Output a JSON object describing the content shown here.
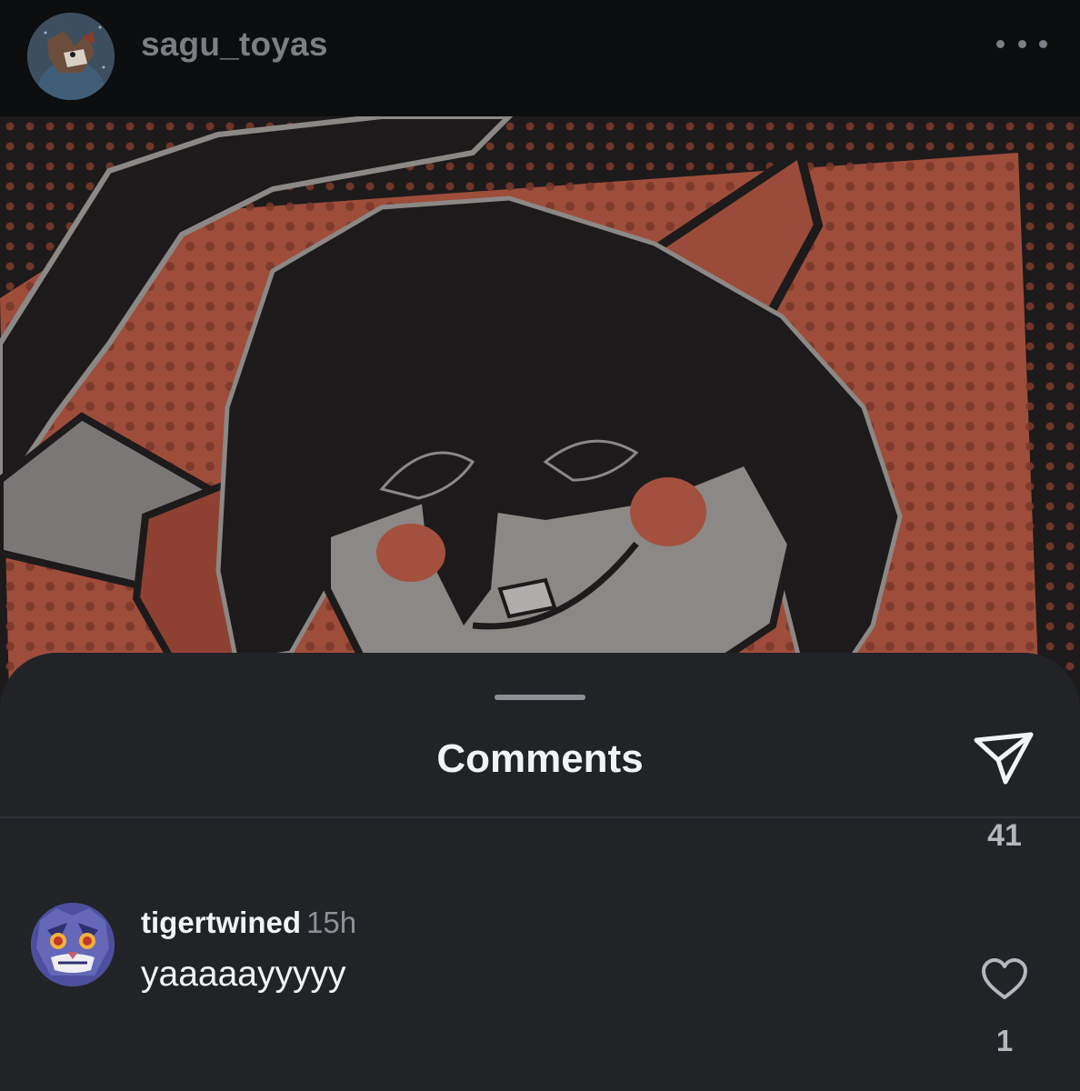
{
  "post": {
    "username": "sagu_toyas",
    "image_description_icon": "artwork-image"
  },
  "sheet": {
    "title": "Comments",
    "share_count": "41"
  },
  "comments": [
    {
      "author": "tigertwined",
      "time": "15h",
      "text": "yaaaaayyyyy",
      "like_count": "1"
    }
  ],
  "colors": {
    "sheet_bg": "#212327",
    "header_bg": "#0b0d0f",
    "accent_red": "#a4503f"
  }
}
